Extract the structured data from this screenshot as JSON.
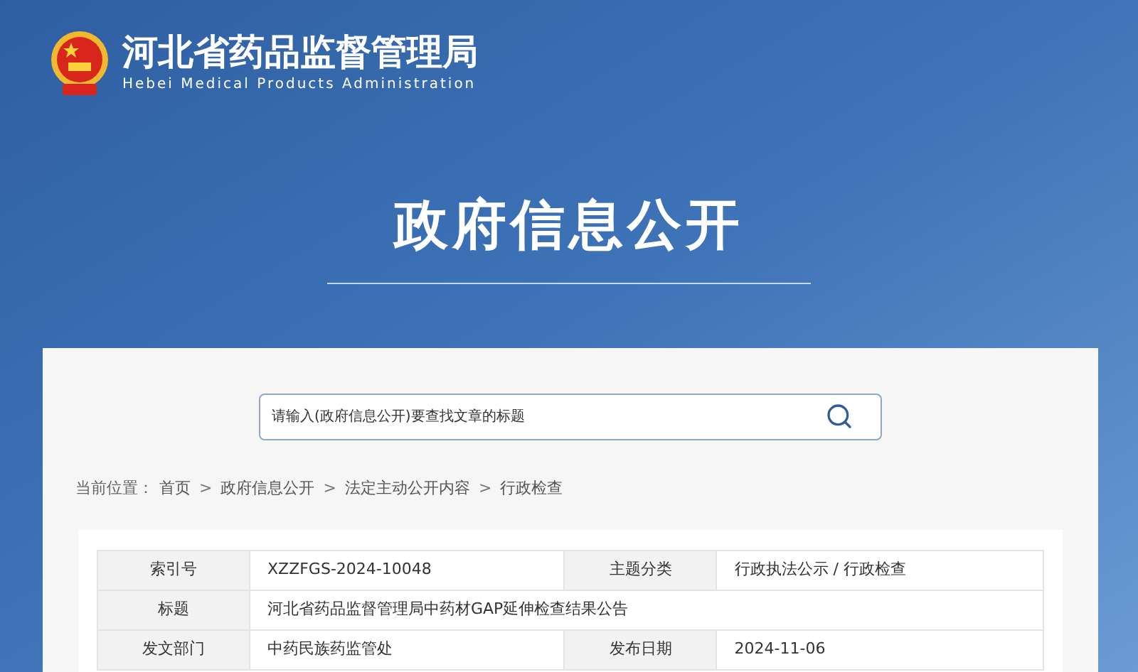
{
  "header": {
    "title": "河北省药品监督管理局",
    "subtitle": "Hebei Medical Products Administration"
  },
  "banner": {
    "title": "政府信息公开"
  },
  "search": {
    "placeholder": "请输入(政府信息公开)要查找文章的标题"
  },
  "breadcrumb": [
    {
      "kind": "label",
      "text": "当前位置："
    },
    {
      "kind": "link",
      "text": "首页"
    },
    {
      "kind": "sep",
      "text": ">"
    },
    {
      "kind": "link",
      "text": "政府信息公开"
    },
    {
      "kind": "sep",
      "text": ">"
    },
    {
      "kind": "link",
      "text": "法定主动公开内容"
    },
    {
      "kind": "sep",
      "text": ">"
    },
    {
      "kind": "link",
      "text": "行政检查"
    }
  ],
  "table": {
    "rows": [
      [
        {
          "kind": "label",
          "text": "索引号"
        },
        {
          "kind": "value",
          "text": "XZZFGS-2024-10048"
        },
        {
          "kind": "label",
          "text": "主题分类"
        },
        {
          "kind": "value",
          "text": "行政执法公示 / 行政检查"
        }
      ],
      [
        {
          "kind": "label",
          "text": "标题"
        },
        {
          "kind": "wide",
          "colspan": 3,
          "text": "河北省药品监督管理局中药材GAP延伸检查结果公告"
        }
      ],
      [
        {
          "kind": "label",
          "text": "发文部门"
        },
        {
          "kind": "value",
          "text": "中药民族药监管处"
        },
        {
          "kind": "label",
          "text": "发布日期"
        },
        {
          "kind": "value",
          "text": "2024-11-06"
        }
      ]
    ]
  }
}
